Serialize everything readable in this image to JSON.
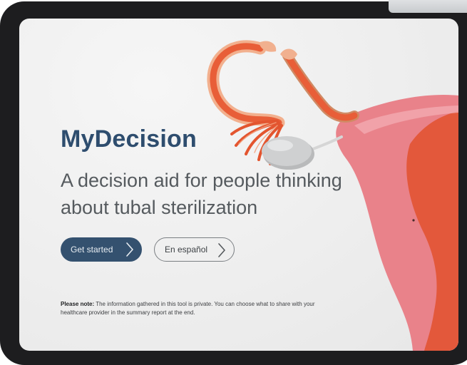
{
  "hero": {
    "brand": "MyDecision",
    "tagline": "A decision aid for people thinking about tubal sterilization"
  },
  "actions": {
    "get_started_label": "Get started",
    "spanish_label": "En español"
  },
  "note": {
    "label": "Please note:",
    "text": "The information gathered in this tool is private. You can choose what to share with your healthcare provider in the summary report at the end."
  },
  "icons": {
    "get_started_icon": "chevron-right-icon",
    "spanish_icon": "chevron-right-icon",
    "illustration": "reproductive-anatomy-illustration"
  },
  "colors": {
    "brand": "#2e4d6e",
    "primary_button": "#34516f",
    "tube_orange": "#e2583a",
    "uterus_pink": "#e9828a",
    "ovary_gray": "#c9cacb"
  }
}
